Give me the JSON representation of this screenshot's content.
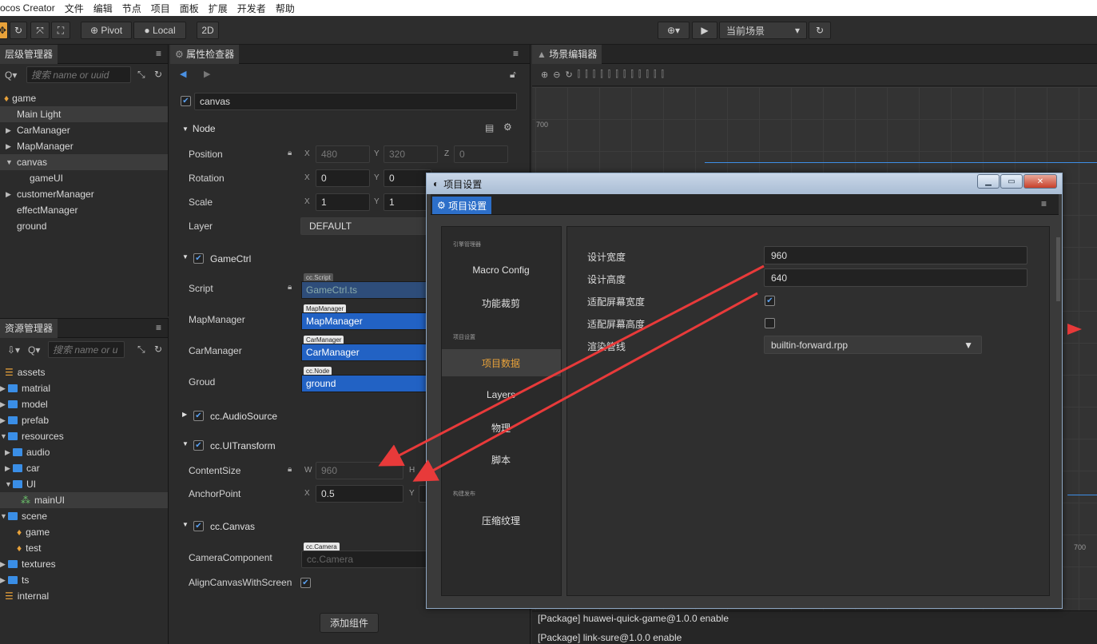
{
  "menubar": [
    "ocos Creator",
    "文件",
    "编辑",
    "节点",
    "项目",
    "面板",
    "扩展",
    "开发者",
    "帮助"
  ],
  "toolbar": {
    "pivot": "Pivot",
    "local": "Local",
    "mode2d": "2D",
    "scene_select": "当前场景"
  },
  "hierarchy": {
    "title": "层级管理器",
    "search_placeholder": "搜索 name or uuid",
    "items": [
      "game",
      "Main Light",
      "CarManager",
      "MapManager",
      "canvas",
      "gameUI",
      "customerManager",
      "effectManager",
      "ground"
    ]
  },
  "assets": {
    "title": "资源管理器",
    "search_placeholder": "搜索 name or u",
    "items": [
      "assets",
      "matrial",
      "model",
      "prefab",
      "resources",
      "audio",
      "car",
      "UI",
      "mainUI",
      "scene",
      "game",
      "test",
      "textures",
      "ts",
      "internal"
    ]
  },
  "inspector": {
    "title": "属性检查器",
    "node_name": "canvas",
    "node_section": "Node",
    "position_label": "Position",
    "position": {
      "x": "480",
      "y": "320",
      "z": "0"
    },
    "rotation_label": "Rotation",
    "rotation": {
      "x": "0",
      "y": "0"
    },
    "scale_label": "Scale",
    "scale": {
      "x": "1",
      "y": "1"
    },
    "layer_label": "Layer",
    "layer": "DEFAULT",
    "gamectrl": "GameCtrl",
    "script_label": "Script",
    "script_tag": "cc.Script",
    "script_value": "GameCtrl.ts",
    "mapmanager_label": "MapManager",
    "mapmanager_tag": "MapManager",
    "mapmanager_value": "MapManager",
    "carmanager_label": "CarManager",
    "carmanager_tag": "CarManager",
    "carmanager_value": "CarManager",
    "groud_label": "Groud",
    "groud_tag": "cc.Node",
    "groud_value": "ground",
    "audiosource": "cc.AudioSource",
    "uitransform": "cc.UITransform",
    "contentsize_label": "ContentSize",
    "contentsize_w": "960",
    "anchor_label": "AnchorPoint",
    "anchor_x": "0.5",
    "canvas_section": "cc.Canvas",
    "camera_label": "CameraComponent",
    "camera_tag": "cc.Camera",
    "camera_value": "cc.Camera",
    "align_label": "AlignCanvasWithScreen",
    "add_component": "添加组件",
    "axis": {
      "x": "X",
      "y": "Y",
      "z": "Z",
      "w": "W",
      "h": "H"
    }
  },
  "scene": {
    "title": "场景编辑器",
    "ruler_top": "700",
    "ruler_bottom": "700"
  },
  "console": [
    "[Package] huawei-quick-game@1.0.0 enable",
    "[Package] link-sure@1.0.0 enable"
  ],
  "dialog": {
    "window_title": "项目设置",
    "tab": "项目设置",
    "side": {
      "cat_engine": "引擎管理器",
      "macro": "Macro Config",
      "feature": "功能裁剪",
      "cat_project": "项目设置",
      "project_data": "项目数据",
      "layers": "Layers",
      "physics": "物理",
      "script": "脚本",
      "cat_build": "构建发布",
      "compress": "压缩纹理"
    },
    "design_width_label": "设计宽度",
    "design_width": "960",
    "design_height_label": "设计高度",
    "design_height": "640",
    "fit_width_label": "适配屏幕宽度",
    "fit_height_label": "适配屏幕高度",
    "render_pipeline_label": "渲染管线",
    "render_pipeline": "builtin-forward.rpp"
  },
  "colors": {
    "accent": "#2262c4",
    "highlight": "#e8a23a",
    "annotation": "#e83a3a"
  }
}
